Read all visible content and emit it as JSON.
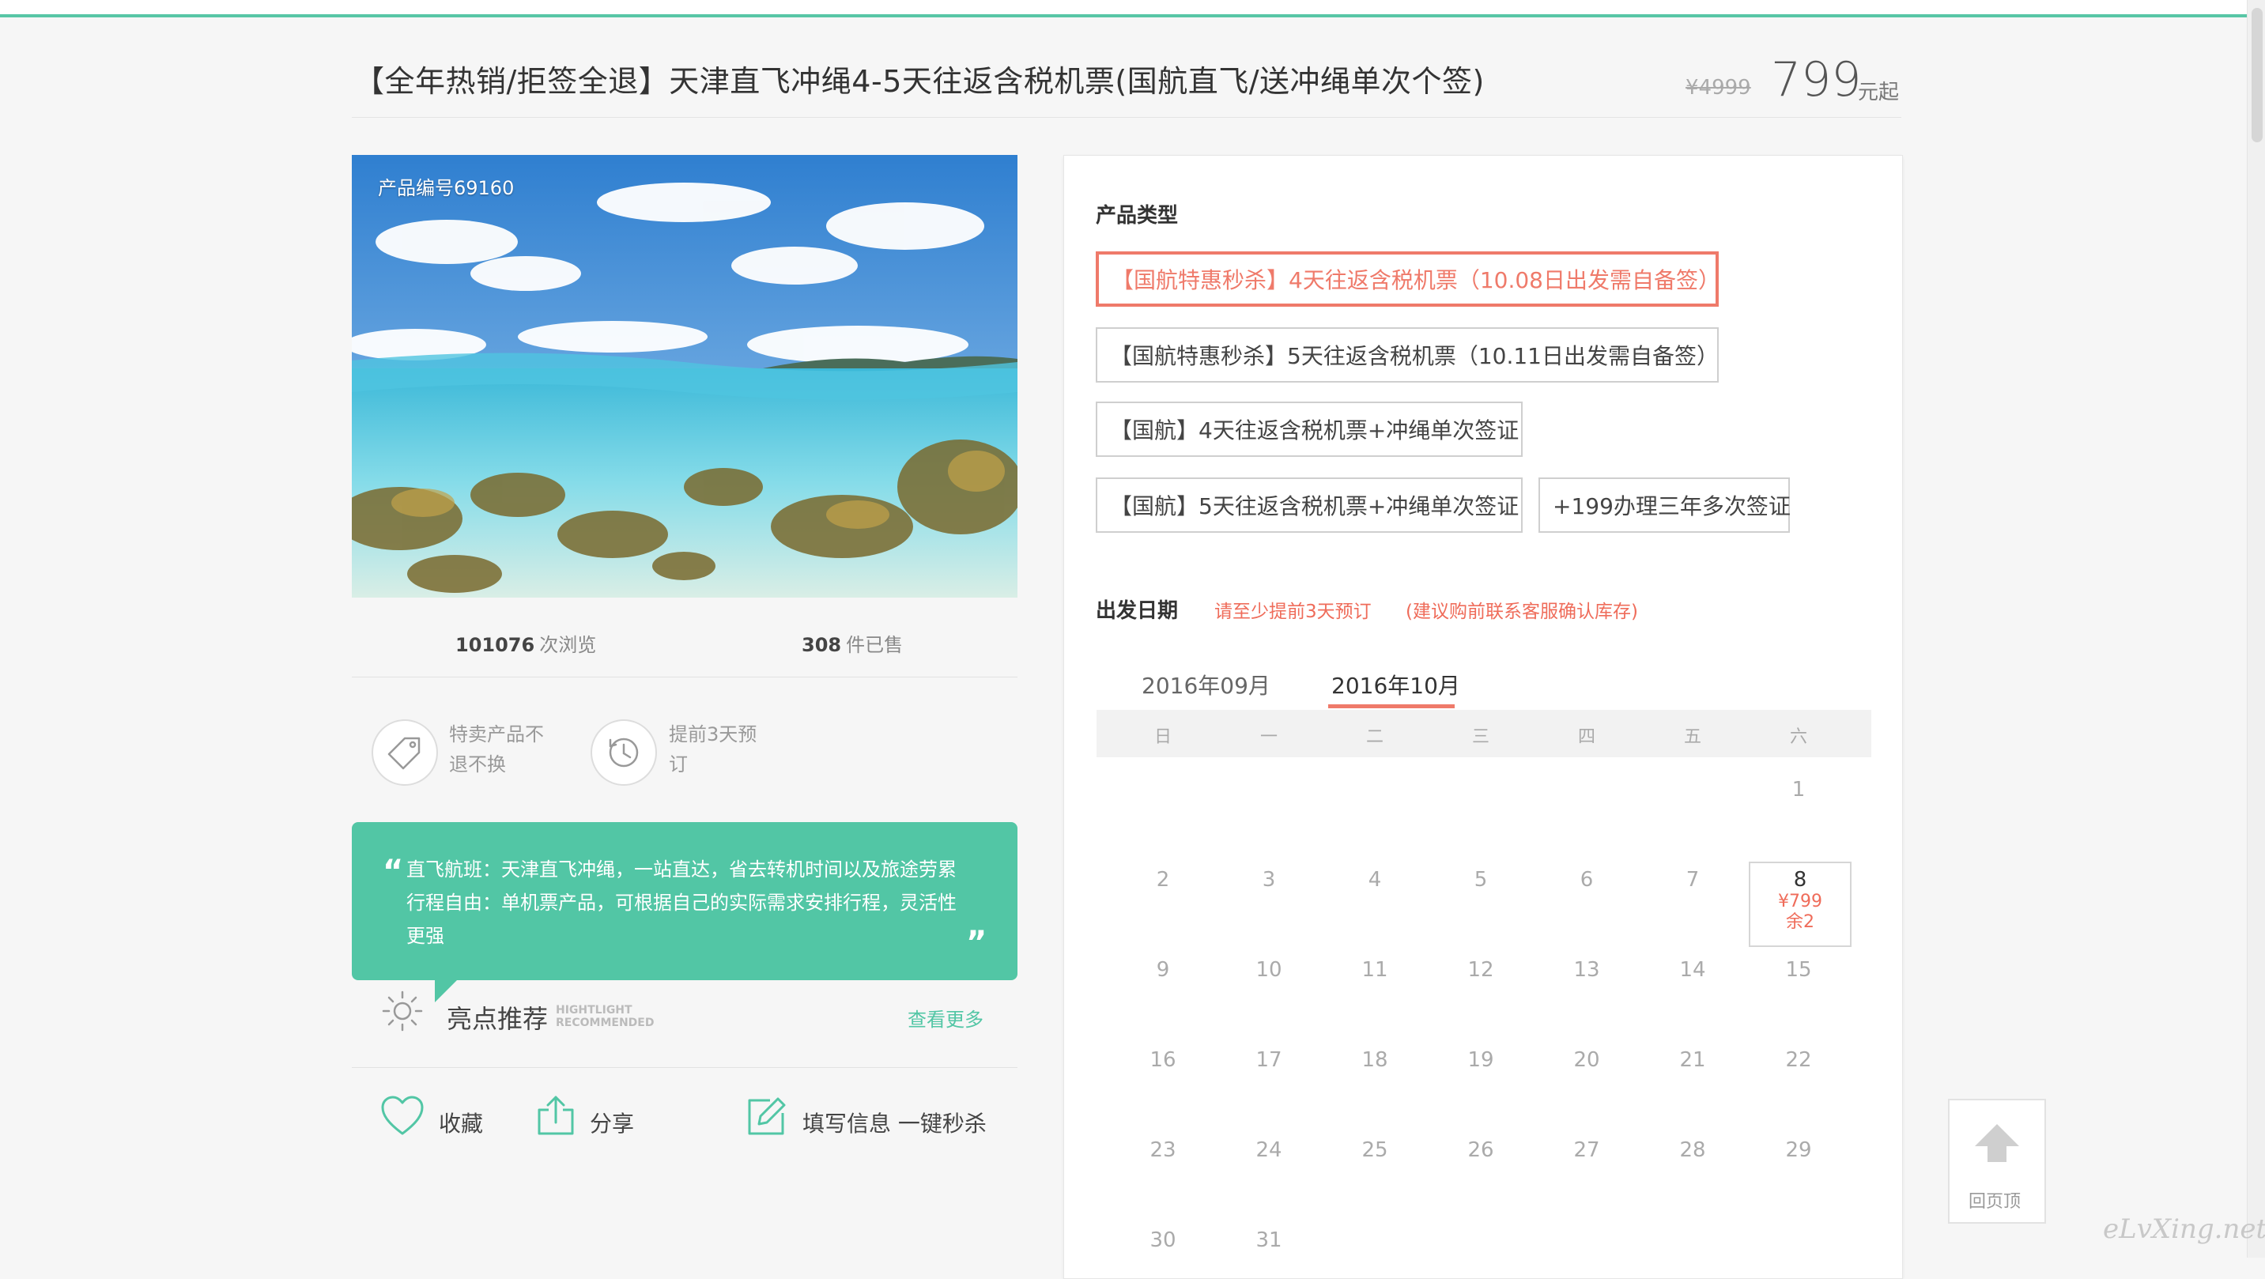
{
  "header": {
    "title": "【全年热销/拒签全退】天津直飞冲绳4-5天往返含税机票(国航直飞/送冲绳单次个签)",
    "old_price": "¥4999",
    "price": "799",
    "price_unit": "元起"
  },
  "left": {
    "product_no": "产品编号69160",
    "views_count": "101076",
    "views_label": "次浏览",
    "sold_count": "308",
    "sold_label": "件已售",
    "features": [
      {
        "icon": "tag-icon",
        "line1": "特卖产品不",
        "line2": "退不换"
      },
      {
        "icon": "clock-icon",
        "line1": "提前3天预",
        "line2": "订"
      }
    ],
    "quote_lines": [
      "直飞航班：天津直飞冲绳，一站直达，省去转机时间以及旅途劳累",
      "行程自由：单机票产品，可根据自己的实际需求安排行程，灵活性",
      "更强"
    ],
    "highlight_title": "亮点推荐",
    "highlight_en_1": "HIGHTLIGHT",
    "highlight_en_2": "RECOMMENDED",
    "highlight_more": "查看更多",
    "actions": {
      "favorite": "收藏",
      "share": "分享",
      "order": "填写信息 一键秒杀"
    }
  },
  "panel": {
    "product_type_title": "产品类型",
    "options": [
      "【国航特惠秒杀】4天往返含税机票（10.08日出发需自备签）",
      "【国航特惠秒杀】5天往返含税机票（10.11日出发需自备签）",
      "【国航】4天往返含税机票+冲绳单次签证",
      "【国航】5天往返含税机票+冲绳单次签证",
      "+199办理三年多次签证"
    ],
    "date_title": "出发日期",
    "date_hint_1": "请至少提前3天预订",
    "date_hint_2": "(建议购前联系客服确认库存)",
    "months": [
      "2016年09月",
      "2016年10月"
    ],
    "weekdays": [
      "日",
      "一",
      "二",
      "三",
      "四",
      "五",
      "六"
    ],
    "active_day": {
      "day": "8",
      "price": "¥799",
      "stock": "余2"
    }
  },
  "back_to_top": "回页顶",
  "watermark": "eLvXing.net",
  "colors": {
    "accent_green": "#52c6a5",
    "accent_red": "#ef7a6a"
  }
}
